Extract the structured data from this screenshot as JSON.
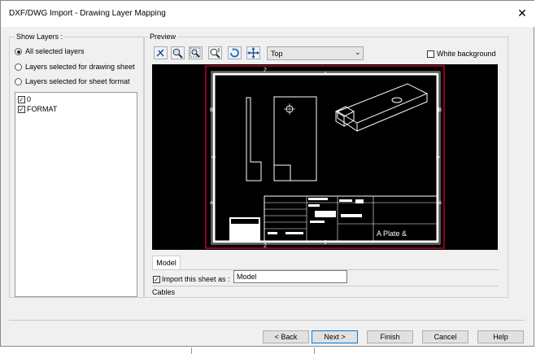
{
  "window": {
    "title": "DXF/DWG Import - Drawing Layer Mapping",
    "close_glyph": "✕"
  },
  "show_layers": {
    "label": "Show Layers :",
    "options": [
      {
        "label": "All selected layers",
        "selected": true
      },
      {
        "label": "Layers selected for drawing sheet",
        "selected": false
      },
      {
        "label": "Layers selected for sheet format",
        "selected": false
      }
    ],
    "layers": [
      {
        "name": "0",
        "checked": true
      },
      {
        "name": "FORMAT",
        "checked": true
      }
    ]
  },
  "preview": {
    "label": "Preview",
    "toolbar_icons": [
      "redraw-icon",
      "zoom-to-fit-icon",
      "zoom-to-area-icon",
      "zoom-in-out-icon",
      "rotate-icon",
      "pan-icon"
    ],
    "view": "Top",
    "white_background_label": "White background",
    "white_background_checked": false,
    "drawing": {
      "zone_top": "2",
      "zone_bottom": "2",
      "zone_left_upper": "B",
      "zone_left_lower": "A",
      "zone_right_upper": "B",
      "zone_right_lower": "A",
      "title_block_text": "A  Plate &"
    }
  },
  "sheet": {
    "tab_label": "Model",
    "import_label": "Import this sheet as :",
    "import_checked": true,
    "import_value": "Model",
    "status_text": "Cables"
  },
  "buttons": {
    "back": "< Back",
    "next": "Next >",
    "finish": "Finish",
    "cancel": "Cancel",
    "help": "Help"
  },
  "colors": {
    "sheet_border": "#b8002b",
    "preview_bg": "#000000",
    "default_button": "#0078d7"
  }
}
